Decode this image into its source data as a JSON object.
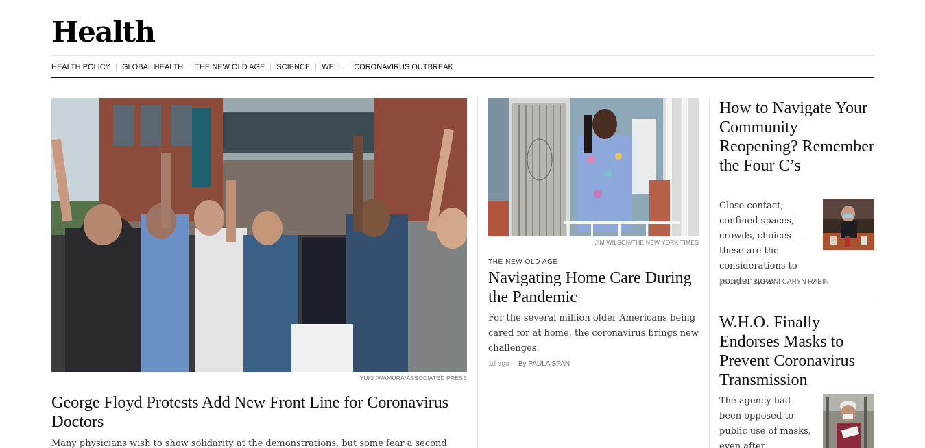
{
  "section": {
    "title": "Health"
  },
  "subnav": [
    {
      "label": "HEALTH POLICY"
    },
    {
      "label": "GLOBAL HEALTH"
    },
    {
      "label": "THE NEW OLD AGE"
    },
    {
      "label": "SCIENCE"
    },
    {
      "label": "WELL"
    },
    {
      "label": "CORONAVIRUS OUTBREAK"
    }
  ],
  "lead": {
    "credit": "YUKI IWAMURA/ASSOCIATED PRESS",
    "headline": "George Floyd Protests Add New Front Line for Coronavirus Doctors",
    "summary": "Many physicians wish to show solidarity at the demonstrations, but some fear a second"
  },
  "middle": {
    "credit": "JIM WILSON/THE NEW YORK TIMES",
    "kicker": "THE NEW OLD AGE",
    "headline": "Navigating Home Care During the Pandemic",
    "summary": "For the several million older Americans being cared for at home, the coronavirus brings new challenges.",
    "time": "1d ago",
    "author": "By PAULA SPAN"
  },
  "right": [
    {
      "headline": "How to Navigate Your Community Reopening? Remember the Four C’s",
      "summary": "Close contact, confined spaces, crowds, choices — these are the considerations to ponder now.",
      "time": "22h ago",
      "author": "By RONI CARYN RABIN"
    },
    {
      "headline": "W.H.O. Finally Endorses Masks to Prevent Coronavirus Transmission",
      "summary": "The agency had been opposed to public use of masks, even after"
    }
  ],
  "colors": {
    "rule": "#121212",
    "divider": "#e2e2e2",
    "credit": "#777777"
  }
}
